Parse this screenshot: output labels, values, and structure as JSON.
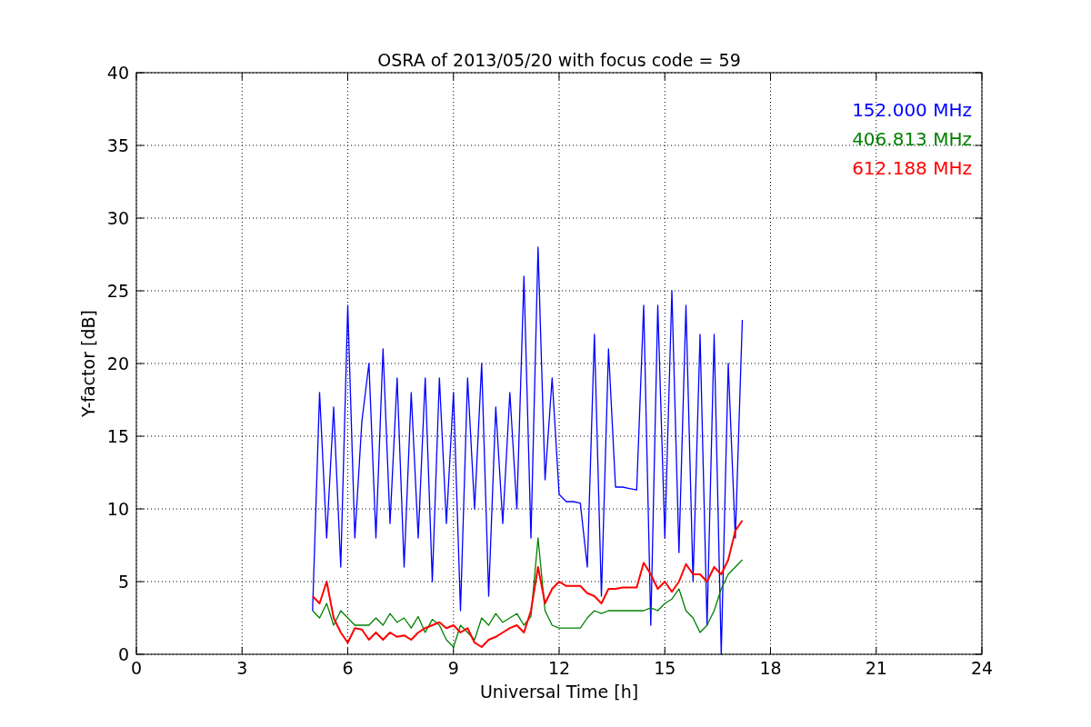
{
  "figure": {
    "chart_data": {
      "type": "line",
      "grid": true,
      "title": "OSRA of 2013/05/20 with focus code = 59",
      "xlabel": "Universal Time [h]",
      "ylabel": "Y-factor [dB]",
      "xlim": [
        0,
        24
      ],
      "ylim": [
        0,
        40
      ],
      "xticks": [
        0,
        3,
        6,
        9,
        12,
        15,
        18,
        21,
        24
      ],
      "yticks": [
        0,
        5,
        10,
        15,
        20,
        25,
        30,
        35,
        40
      ],
      "x": [
        5.0,
        5.2,
        5.4,
        5.6,
        5.8,
        6.0,
        6.2,
        6.4,
        6.6,
        6.8,
        7.0,
        7.2,
        7.4,
        7.6,
        7.8,
        8.0,
        8.2,
        8.4,
        8.6,
        8.8,
        9.0,
        9.2,
        9.4,
        9.6,
        9.8,
        10.0,
        10.2,
        10.4,
        10.6,
        10.8,
        11.0,
        11.2,
        11.4,
        11.6,
        11.8,
        12.0,
        12.2,
        12.4,
        12.6,
        12.8,
        13.0,
        13.2,
        13.4,
        13.6,
        13.8,
        14.0,
        14.2,
        14.4,
        14.6,
        14.8,
        15.0,
        15.2,
        15.4,
        15.6,
        15.8,
        16.0,
        16.2,
        16.4,
        16.6,
        16.8,
        17.0,
        17.2
      ],
      "series": [
        {
          "name": "152.000 MHz",
          "color": "#0000ff",
          "values": [
            3,
            18,
            8,
            17,
            6,
            24,
            8,
            16,
            20,
            8,
            21,
            9,
            19,
            6,
            18,
            8,
            19,
            5,
            19,
            9,
            18,
            3,
            19,
            10,
            20,
            4,
            17,
            9,
            18,
            10,
            26,
            8,
            28,
            12,
            19,
            11,
            10.5,
            10.5,
            10.4,
            6,
            22,
            4,
            21,
            11.5,
            11.5,
            11.4,
            11.3,
            24,
            2,
            24,
            8,
            25,
            7,
            24,
            5,
            22,
            2,
            22,
            0,
            20,
            8,
            23
          ]
        },
        {
          "name": "406.813 MHz",
          "color": "#008000",
          "values": [
            3,
            2.5,
            3.5,
            2,
            3,
            2.5,
            2,
            2,
            2,
            2.5,
            2,
            2.8,
            2.2,
            2.5,
            1.8,
            2.6,
            1.5,
            2.4,
            2,
            1,
            0.5,
            2,
            1.5,
            1,
            2.5,
            2,
            2.8,
            2.2,
            2.5,
            2.8,
            2,
            2.6,
            8,
            3,
            2,
            1.8,
            1.8,
            1.8,
            1.8,
            2.5,
            3,
            2.8,
            3,
            3,
            3,
            3,
            3,
            3,
            3.2,
            3,
            3.5,
            3.8,
            4.5,
            3,
            2.5,
            1.5,
            2,
            3,
            4.5,
            5.5,
            6,
            6.5
          ]
        },
        {
          "name": "612.188 MHz",
          "color": "#ff0000",
          "values": [
            4,
            3.5,
            5,
            2.5,
            1.5,
            0.8,
            1.8,
            1.7,
            1,
            1.5,
            1,
            1.5,
            1.2,
            1.3,
            1,
            1.5,
            1.8,
            2,
            2.2,
            1.8,
            2,
            1.5,
            1.8,
            0.8,
            0.5,
            1,
            1.2,
            1.5,
            1.8,
            2,
            1.5,
            3,
            6,
            3.5,
            4.5,
            5,
            4.7,
            4.7,
            4.7,
            4.2,
            4,
            3.5,
            4.5,
            4.5,
            4.6,
            4.6,
            4.6,
            6.3,
            5.5,
            4.5,
            5,
            4.3,
            5,
            6.2,
            5.5,
            5.5,
            5,
            6,
            5.5,
            6.5,
            8.5,
            9.2
          ]
        }
      ]
    }
  }
}
